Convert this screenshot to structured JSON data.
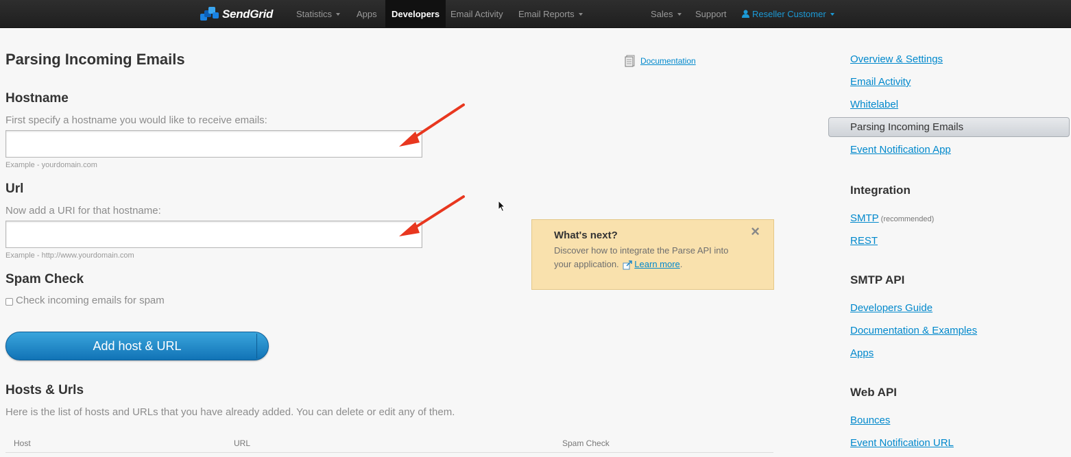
{
  "topnav": {
    "logo_text": "SendGrid",
    "items": [
      {
        "label": "Statistics",
        "dropdown": true
      },
      {
        "label": "Apps",
        "dropdown": false
      },
      {
        "label": "Developers",
        "dropdown": false,
        "active": true
      },
      {
        "label": "Email Activity",
        "dropdown": false
      },
      {
        "label": "Email Reports",
        "dropdown": true
      },
      {
        "label": "Sales",
        "dropdown": true
      },
      {
        "label": "Support",
        "dropdown": false
      },
      {
        "label": "Reseller Customer",
        "dropdown": true
      }
    ]
  },
  "main": {
    "title": "Parsing Incoming Emails",
    "documentation_link": "Documentation",
    "hostname": {
      "heading": "Hostname",
      "help": "First specify a hostname you would like to receive emails:",
      "value": "",
      "example": "Example - yourdomain.com"
    },
    "url": {
      "heading": "Url",
      "help": "Now add a URI for that hostname:",
      "value": "",
      "example": "Example - http://www.yourdomain.com"
    },
    "spam": {
      "heading": "Spam Check",
      "checkbox_label": "Check incoming emails for spam",
      "checked": false
    },
    "add_button": "Add host & URL",
    "hosts": {
      "heading": "Hosts & Urls",
      "help": "Here is the list of hosts and URLs that you have already added. You can delete or edit any of them.",
      "columns": [
        "Host",
        "URL",
        "Spam Check"
      ]
    }
  },
  "whats_next": {
    "title": "What's next?",
    "body_line1": "Discover how to integrate the Parse API into",
    "body_line2": "your application.",
    "link": "Learn more",
    "trail": ".",
    "close": "×"
  },
  "sidebar": {
    "links": [
      "Overview & Settings",
      "Email Activity",
      "Whitelabel"
    ],
    "active": "Parsing Incoming Emails",
    "link_after_active": "Event Notification App",
    "integration": {
      "heading": "Integration",
      "smtp": "SMTP",
      "smtp_note": "(recommended)",
      "rest": "REST"
    },
    "smtp_api": {
      "heading": "SMTP API",
      "links": [
        "Developers Guide",
        "Documentation & Examples",
        "Apps"
      ]
    },
    "web_api": {
      "heading": "Web API",
      "links": [
        "Bounces",
        "Event Notification URL"
      ]
    }
  },
  "colors": {
    "nav_bg": "#2e2e2e",
    "link": "#0088cc",
    "button": "#1c86c8",
    "notice_bg": "#f9e1ad",
    "annotation_arrow": "#e8371f"
  }
}
